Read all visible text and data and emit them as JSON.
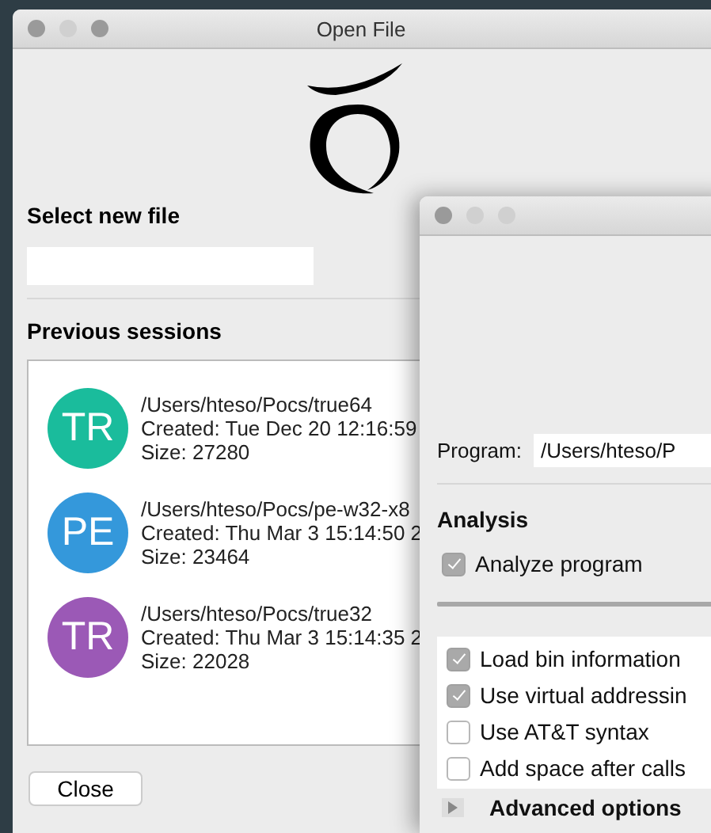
{
  "open_file_window": {
    "title": "Open File",
    "select_file": {
      "label": "Select new file"
    },
    "previous_sessions": {
      "label": "Previous sessions",
      "items": [
        {
          "initials": "TR",
          "color": "#1abc9c",
          "path": "/Users/hteso/Pocs/true64",
          "created": "Created: Tue Dec 20 12:16:59",
          "size": "Size: 27280"
        },
        {
          "initials": "PE",
          "color": "#3498db",
          "path": "/Users/hteso/Pocs/pe-w32-x8",
          "created": "Created: Thu Mar 3 15:14:50 2",
          "size": "Size: 23464"
        },
        {
          "initials": "TR",
          "color": "#9b59b6",
          "path": "/Users/hteso/Pocs/true32",
          "created": "Created: Thu Mar 3 15:14:35 2",
          "size": "Size: 22028"
        }
      ]
    },
    "close_button": "Close"
  },
  "load_options_window": {
    "program": {
      "label": "Program:",
      "value": "/Users/hteso/P"
    },
    "analysis": {
      "heading": "Analysis",
      "analyze_program": {
        "label": "Analyze program",
        "checked": true
      }
    },
    "options": [
      {
        "label": "Load bin information",
        "checked": true
      },
      {
        "label": "Use virtual addressin",
        "checked": true
      },
      {
        "label": "Use AT&T syntax",
        "checked": false
      },
      {
        "label": "Add space after calls",
        "checked": false
      }
    ],
    "advanced_options": {
      "label": "Advanced options",
      "expanded": false
    }
  }
}
